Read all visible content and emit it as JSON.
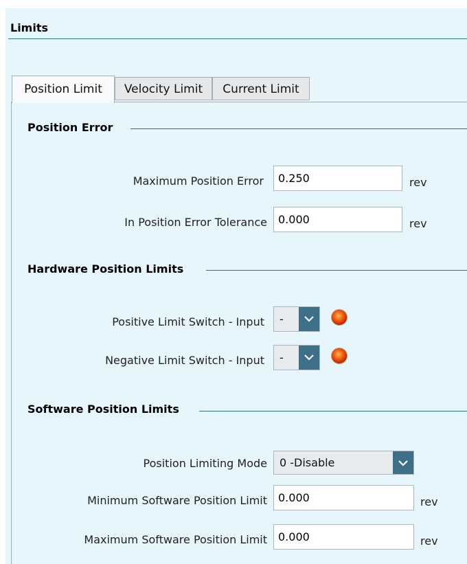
{
  "panel": {
    "title": "Limits"
  },
  "tabs": [
    {
      "label": "Position Limit",
      "active": true
    },
    {
      "label": "Velocity Limit",
      "active": false
    },
    {
      "label": "Current Limit",
      "active": false
    }
  ],
  "position_error": {
    "title": "Position Error",
    "max_error": {
      "label": "Maximum Position Error",
      "value": "0.250",
      "unit": "rev"
    },
    "tolerance": {
      "label": "In Position Error Tolerance",
      "value": "0.000",
      "unit": "rev"
    }
  },
  "hardware_limits": {
    "title": "Hardware Position Limits",
    "positive": {
      "label": "Positive Limit Switch - Input",
      "value": "-",
      "indicator_color": "#ef5a0c"
    },
    "negative": {
      "label": "Negative Limit Switch - Input",
      "value": "-",
      "indicator_color": "#ef5a0c"
    }
  },
  "software_limits": {
    "title": "Software Position Limits",
    "mode": {
      "label": "Position Limiting Mode",
      "value": "0  -Disable"
    },
    "min": {
      "label": "Minimum Software Position Limit",
      "value": "0.000",
      "unit": "rev"
    },
    "max": {
      "label": "Maximum Software Position Limit",
      "value": "0.000",
      "unit": "rev"
    }
  },
  "colors": {
    "accent": "#3d6f88",
    "panel_bg": "#e6f6fb",
    "rule": "#2f7187"
  },
  "icons": {
    "dropdown": "chevron-down-icon",
    "status": "led-indicator-icon"
  }
}
